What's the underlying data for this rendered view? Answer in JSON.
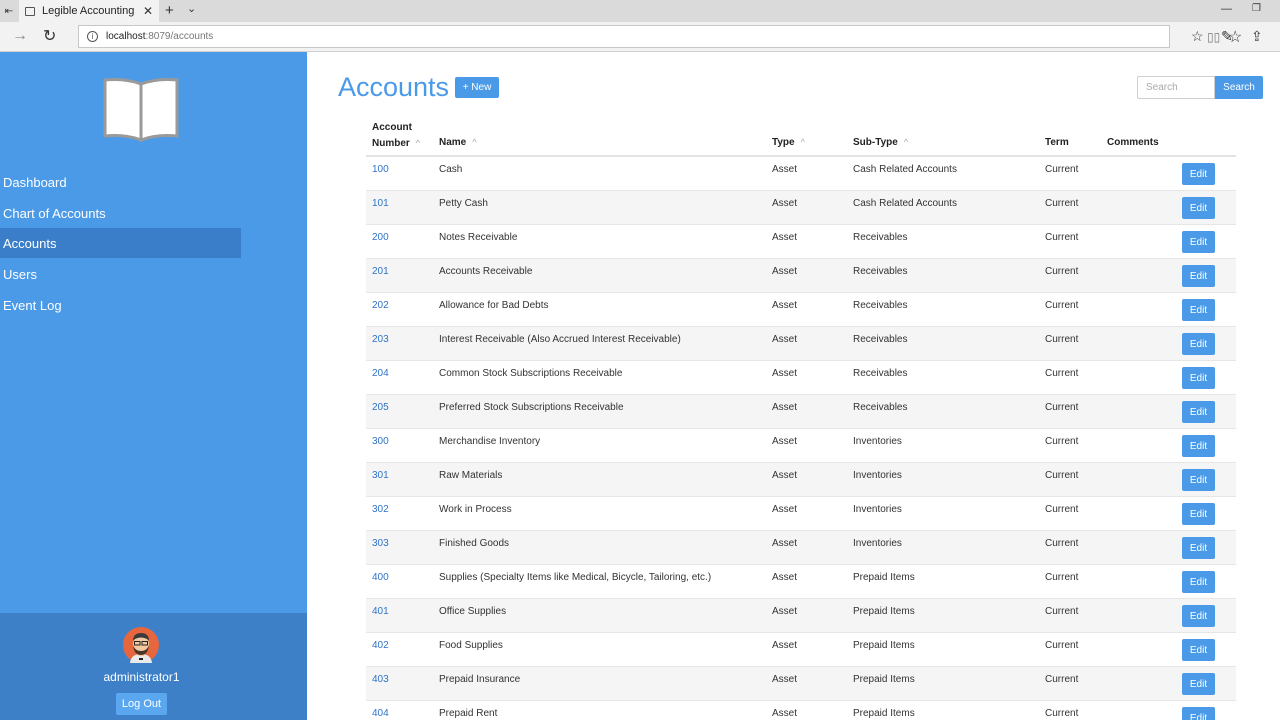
{
  "browser": {
    "tab_title": "Legible Accounting",
    "url_host": "localhost",
    "url_path": ":8079/accounts"
  },
  "sidebar": {
    "nav": [
      {
        "label": "Dashboard",
        "active": false
      },
      {
        "label": "Chart of Accounts",
        "active": false
      },
      {
        "label": "Accounts",
        "active": true
      },
      {
        "label": "Users",
        "active": false
      },
      {
        "label": "Event Log",
        "active": false
      }
    ],
    "user": {
      "name": "administrator1",
      "logout_label": "Log Out"
    }
  },
  "main": {
    "title": "Accounts",
    "new_label": "+ New",
    "search_placeholder": "Search",
    "search_label": "Search",
    "edit_label": "Edit",
    "columns": {
      "number_line1": "Account",
      "number_line2": "Number",
      "name": "Name",
      "type": "Type",
      "subtype": "Sub-Type",
      "term": "Term",
      "comments": "Comments"
    },
    "rows": [
      {
        "number": "100",
        "name": "Cash",
        "type": "Asset",
        "subtype": "Cash Related Accounts",
        "term": "Current"
      },
      {
        "number": "101",
        "name": "Petty Cash",
        "type": "Asset",
        "subtype": "Cash Related Accounts",
        "term": "Current"
      },
      {
        "number": "200",
        "name": "Notes Receivable",
        "type": "Asset",
        "subtype": "Receivables",
        "term": "Current"
      },
      {
        "number": "201",
        "name": "Accounts Receivable",
        "type": "Asset",
        "subtype": "Receivables",
        "term": "Current"
      },
      {
        "number": "202",
        "name": "Allowance for Bad Debts",
        "type": "Asset",
        "subtype": "Receivables",
        "term": "Current"
      },
      {
        "number": "203",
        "name": "Interest Receivable (Also Accrued Interest Receivable)",
        "type": "Asset",
        "subtype": "Receivables",
        "term": "Current"
      },
      {
        "number": "204",
        "name": "Common Stock Subscriptions Receivable",
        "type": "Asset",
        "subtype": "Receivables",
        "term": "Current"
      },
      {
        "number": "205",
        "name": "Preferred Stock Subscriptions Receivable",
        "type": "Asset",
        "subtype": "Receivables",
        "term": "Current"
      },
      {
        "number": "300",
        "name": "Merchandise Inventory",
        "type": "Asset",
        "subtype": "Inventories",
        "term": "Current"
      },
      {
        "number": "301",
        "name": "Raw Materials",
        "type": "Asset",
        "subtype": "Inventories",
        "term": "Current"
      },
      {
        "number": "302",
        "name": "Work in Process",
        "type": "Asset",
        "subtype": "Inventories",
        "term": "Current"
      },
      {
        "number": "303",
        "name": "Finished Goods",
        "type": "Asset",
        "subtype": "Inventories",
        "term": "Current"
      },
      {
        "number": "400",
        "name": "Supplies (Specialty Items like Medical, Bicycle, Tailoring, etc.)",
        "type": "Asset",
        "subtype": "Prepaid Items",
        "term": "Current"
      },
      {
        "number": "401",
        "name": "Office Supplies",
        "type": "Asset",
        "subtype": "Prepaid Items",
        "term": "Current"
      },
      {
        "number": "402",
        "name": "Food Supplies",
        "type": "Asset",
        "subtype": "Prepaid Items",
        "term": "Current"
      },
      {
        "number": "403",
        "name": "Prepaid Insurance",
        "type": "Asset",
        "subtype": "Prepaid Items",
        "term": "Current"
      },
      {
        "number": "404",
        "name": "Prepaid Rent",
        "type": "Asset",
        "subtype": "Prepaid Items",
        "term": "Current"
      }
    ]
  },
  "colors": {
    "accent": "#4a9ae8",
    "sidebar_active": "#3a7ec9",
    "link": "#2f73c8"
  }
}
